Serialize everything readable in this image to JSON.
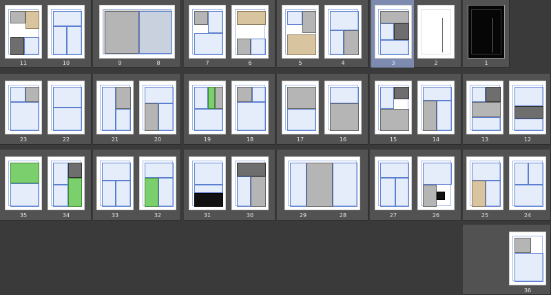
{
  "pages": {
    "p1": "1",
    "p2": "2",
    "p3": "3",
    "p4": "4",
    "p5": "5",
    "p6": "6",
    "p7": "7",
    "p8": "8",
    "p9": "9",
    "p10": "10",
    "p11": "11",
    "p12": "12",
    "p13": "13",
    "p14": "14",
    "p15": "15",
    "p16": "16",
    "p17": "17",
    "p18": "18",
    "p19": "19",
    "p20": "20",
    "p21": "21",
    "p22": "22",
    "p23": "23",
    "p24": "24",
    "p25": "25",
    "p26": "26",
    "p27": "27",
    "p28": "28",
    "p29": "29",
    "p30": "30",
    "p31": "31",
    "p32": "32",
    "p33": "33",
    "p34": "34",
    "p35": "35",
    "p36": "36"
  },
  "selected_page": "3",
  "colors": {
    "background": "#3a3a3a",
    "spread": "#525252",
    "selected_spread": "#7d8bb0",
    "page": "#ffffff",
    "sketch_blue": "#5c7fd0"
  }
}
